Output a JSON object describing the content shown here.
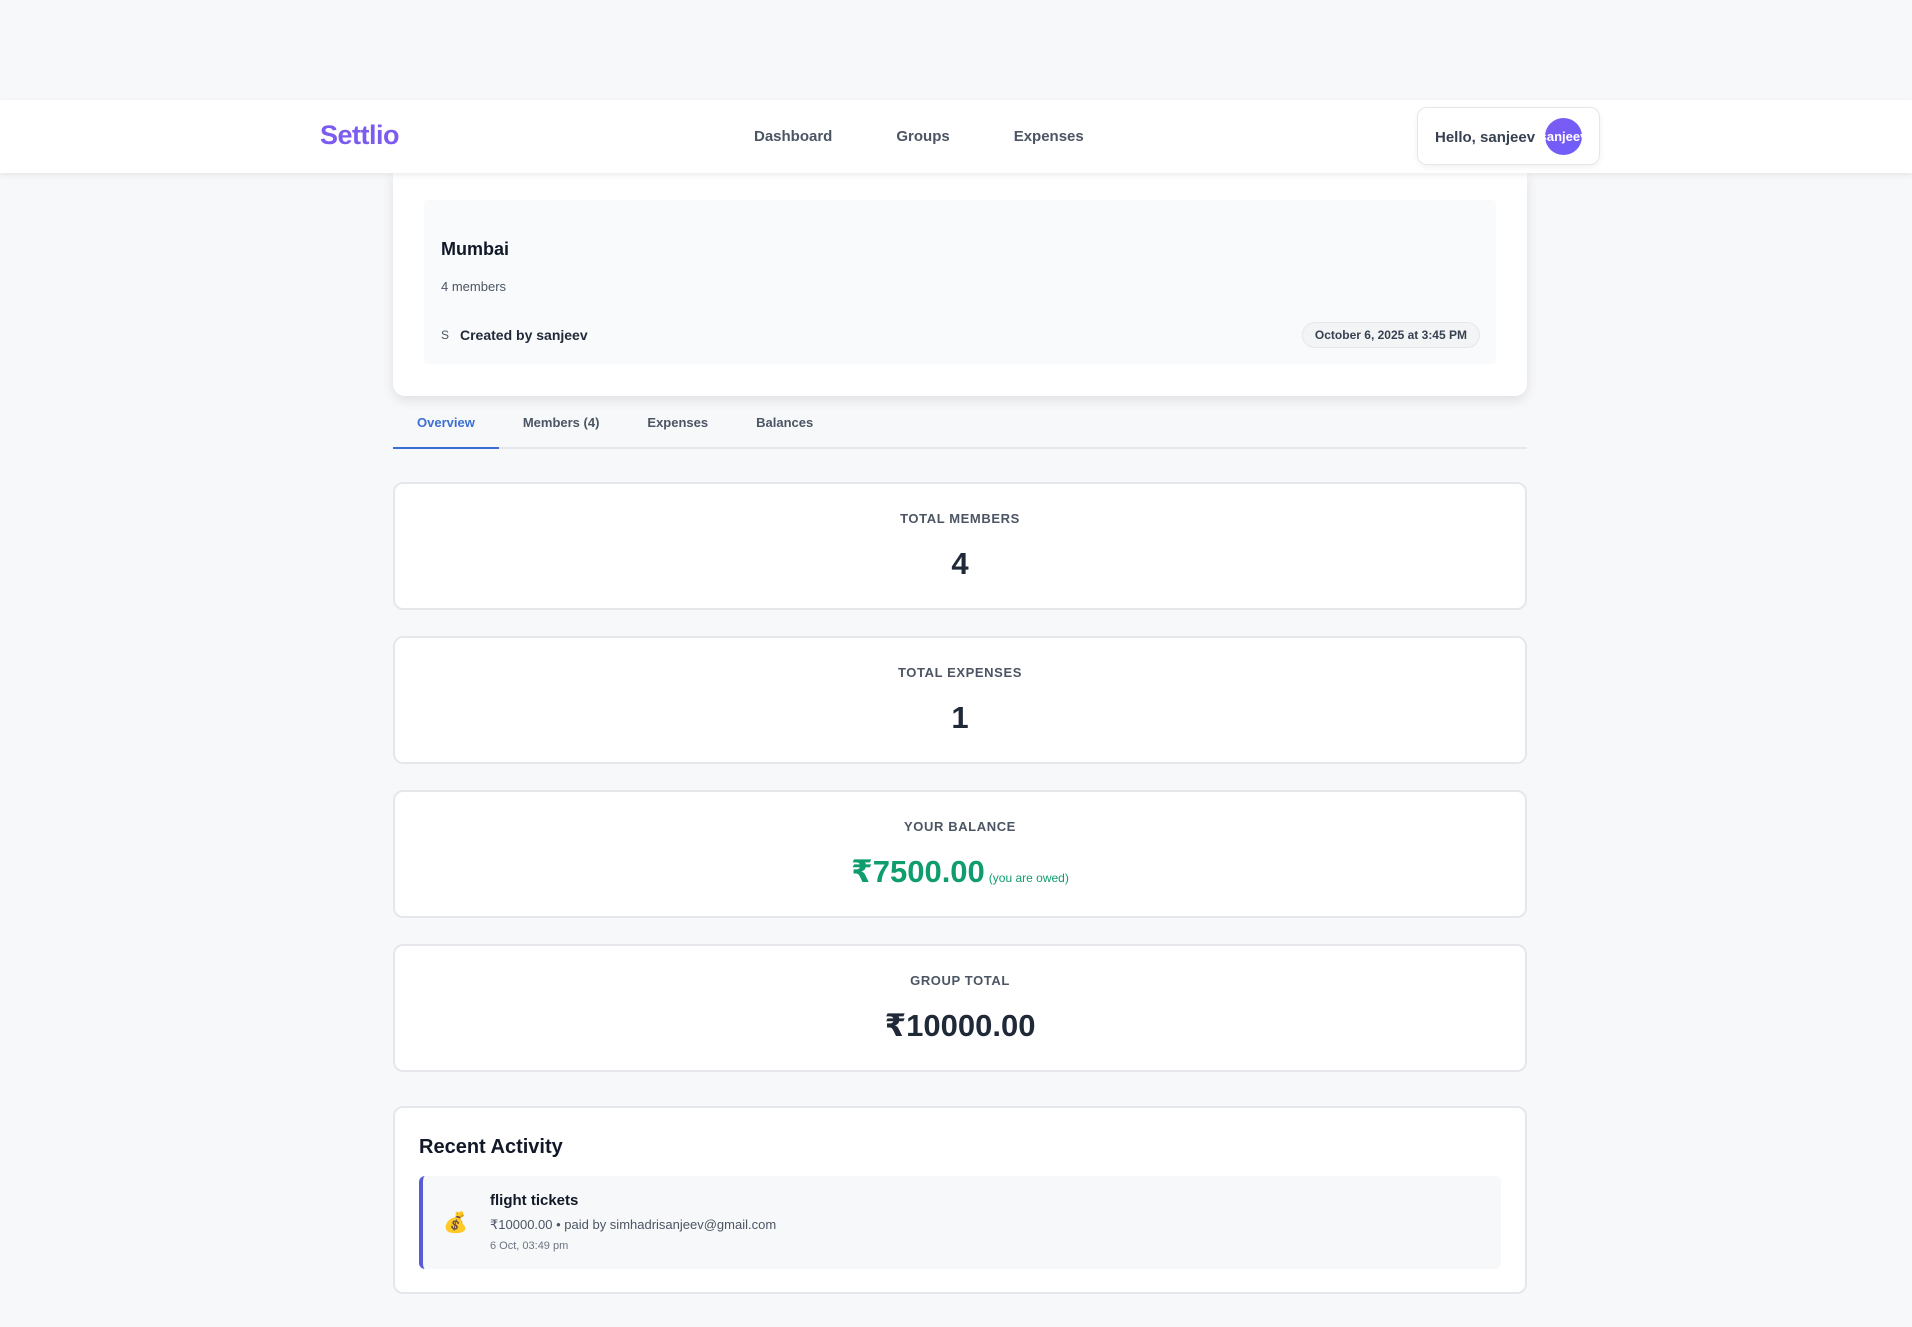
{
  "brand": {
    "name": "Settlio",
    "gradient_start": "#7c5cf0",
    "gradient_end": "#6d5dfc"
  },
  "nav": {
    "links": [
      "Dashboard",
      "Groups",
      "Expenses"
    ],
    "greeting": "Hello, sanjeev",
    "avatar_text": "sanjeev"
  },
  "group": {
    "name": "Mumbai",
    "members_text": "4 members",
    "creator_initial": "S",
    "created_by": "Created by sanjeev",
    "created_at": "October 6, 2025 at 3:45 PM"
  },
  "tabs": [
    {
      "label": "Overview",
      "active": true
    },
    {
      "label": "Members (4)",
      "active": false
    },
    {
      "label": "Expenses",
      "active": false
    },
    {
      "label": "Balances",
      "active": false
    }
  ],
  "stats": {
    "total_members": {
      "label": "Total Members",
      "value": "4"
    },
    "total_expenses": {
      "label": "Total Expenses",
      "value": "1"
    },
    "your_balance": {
      "label": "Your Balance",
      "value": "₹7500.00",
      "note": "(you are owed)",
      "color": "#0f9d6f"
    },
    "group_total": {
      "label": "Group Total",
      "value": "₹10000.00"
    }
  },
  "recent_activity": {
    "title": "Recent Activity",
    "items": [
      {
        "icon": "money-bag-icon",
        "name": "flight tickets",
        "detail": "₹10000.00 • paid by simhadrisanjeev@gmail.com",
        "time": "6 Oct, 03:49 pm"
      }
    ]
  },
  "colors": {
    "accent_tab": "#3b6fd1",
    "activity_border": "#5b5bd6"
  }
}
